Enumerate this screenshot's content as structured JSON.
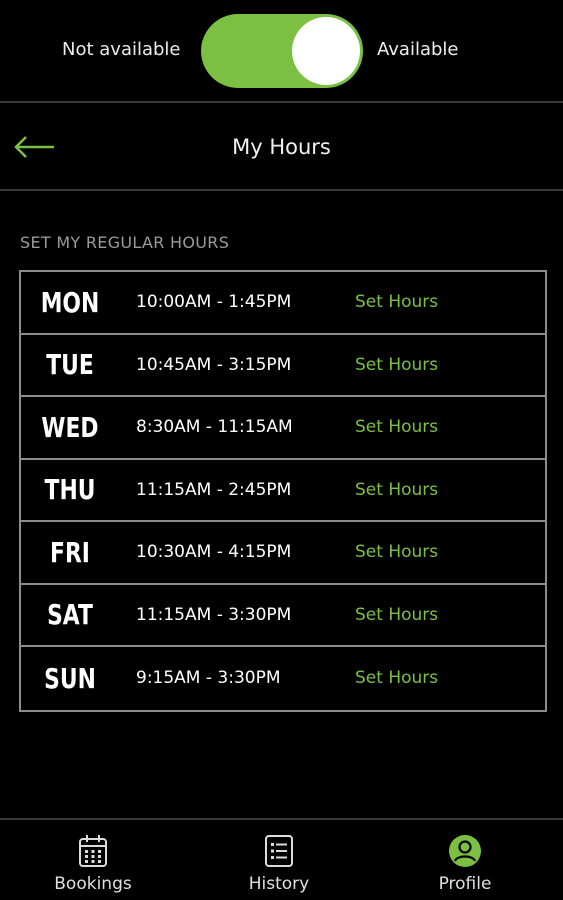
{
  "availability": {
    "left_label": "Not available",
    "right_label": "Available",
    "is_available": true,
    "accent_color": "#7bc043"
  },
  "header": {
    "back_icon": "arrow-left-icon",
    "title": "My Hours"
  },
  "section_label": "SET MY REGULAR HOURS",
  "hours": [
    {
      "day": "MON",
      "time": "10:00AM - 1:45PM",
      "action": "Set Hours"
    },
    {
      "day": "TUE",
      "time": "10:45AM - 3:15PM",
      "action": "Set Hours"
    },
    {
      "day": "WED",
      "time": "8:30AM - 11:15AM",
      "action": "Set Hours"
    },
    {
      "day": "THU",
      "time": "11:15AM - 2:45PM",
      "action": "Set Hours"
    },
    {
      "day": "FRI",
      "time": "10:30AM - 4:15PM",
      "action": "Set Hours"
    },
    {
      "day": "SAT",
      "time": "11:15AM - 3:30PM",
      "action": "Set Hours"
    },
    {
      "day": "SUN",
      "time": "9:15AM - 3:30PM",
      "action": "Set Hours"
    }
  ],
  "bottom_nav": [
    {
      "label": "Bookings",
      "icon": "calendar-icon",
      "active": false
    },
    {
      "label": "History",
      "icon": "list-icon",
      "active": false
    },
    {
      "label": "Profile",
      "icon": "profile-icon",
      "active": true
    }
  ]
}
